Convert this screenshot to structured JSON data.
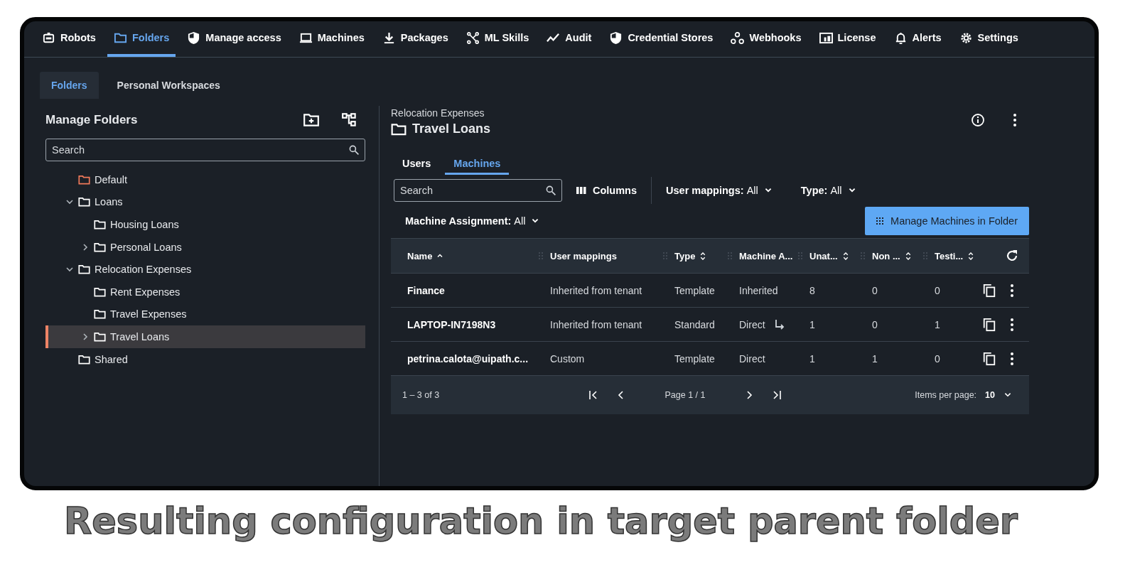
{
  "nav": [
    {
      "label": "Robots",
      "kind": "robot",
      "selected": false
    },
    {
      "label": "Folders",
      "kind": "folder",
      "selected": true
    },
    {
      "label": "Manage access",
      "kind": "shield",
      "selected": false
    },
    {
      "label": "Machines",
      "kind": "laptop",
      "selected": false
    },
    {
      "label": "Packages",
      "kind": "download",
      "selected": false
    },
    {
      "label": "ML Skills",
      "kind": "nodes",
      "selected": false
    },
    {
      "label": "Audit",
      "kind": "trend",
      "selected": false
    },
    {
      "label": "Credential Stores",
      "kind": "shield",
      "selected": false
    },
    {
      "label": "Webhooks",
      "kind": "webhook",
      "selected": false
    },
    {
      "label": "License",
      "kind": "devices",
      "selected": false
    },
    {
      "label": "Alerts",
      "kind": "bell",
      "selected": false
    },
    {
      "label": "Settings",
      "kind": "gear",
      "selected": false
    }
  ],
  "subtabs": [
    {
      "label": "Folders",
      "selected": true
    },
    {
      "label": "Personal Workspaces",
      "selected": false
    }
  ],
  "folders": {
    "title": "Manage Folders",
    "search": {
      "placeholder": "Search"
    },
    "tree": [
      {
        "label": "Default",
        "kind": "default",
        "selected": false
      },
      {
        "label": "Loans",
        "kind": "folder",
        "selected": false,
        "expanded": true,
        "children": [
          {
            "label": "Housing Loans",
            "kind": "folder",
            "selected": false
          },
          {
            "label": "Personal Loans",
            "kind": "folder",
            "selected": false,
            "expanded": false
          }
        ]
      },
      {
        "label": "Relocation Expenses",
        "kind": "folder",
        "selected": false,
        "expanded": true,
        "children": [
          {
            "label": "Rent Expenses",
            "kind": "folder",
            "selected": false
          },
          {
            "label": "Travel Expenses",
            "kind": "folder",
            "selected": false
          },
          {
            "label": "Travel Loans",
            "kind": "folder",
            "selected": true,
            "expanded": false
          }
        ]
      },
      {
        "label": "Shared",
        "kind": "folder",
        "selected": false
      }
    ]
  },
  "detail": {
    "breadcrumb": "Relocation Expenses",
    "title": "Travel Loans",
    "tabs": [
      {
        "label": "Users",
        "selected": false
      },
      {
        "label": "Machines",
        "selected": true
      }
    ],
    "search": {
      "placeholder": "Search"
    },
    "columns_button": "Columns",
    "filters": [
      {
        "label": "User mappings:",
        "value": "All"
      },
      {
        "label": "Type:",
        "value": "All"
      },
      {
        "label": "Machine Assignment:",
        "value": "All"
      }
    ],
    "manage_button": "Manage Machines in Folder",
    "table": {
      "columns": [
        {
          "label": "Name",
          "kind": "sorted"
        },
        {
          "label": "User mappings",
          "kind": "plain"
        },
        {
          "label": "Type",
          "kind": "sortable"
        },
        {
          "label": "Machine A...",
          "kind": "plain"
        },
        {
          "label": "Unat...",
          "kind": "sortable"
        },
        {
          "label": "Non ...",
          "kind": "sortable"
        },
        {
          "label": "Testi...",
          "kind": "sortable"
        }
      ],
      "rows": [
        {
          "cells": [
            "Finance",
            "Inherited from tenant",
            "Template",
            "Inherited",
            "8",
            "0",
            "0"
          ],
          "override_icon": false
        },
        {
          "cells": [
            "LAPTOP-IN7198N3",
            "Inherited from tenant",
            "Standard",
            "Direct",
            "1",
            "0",
            "1"
          ],
          "override_icon": true
        },
        {
          "cells": [
            "petrina.calota@uipath.c...",
            "Custom",
            "Template",
            "Direct",
            "1",
            "1",
            "0"
          ],
          "override_icon": false
        }
      ]
    },
    "pagination": {
      "range": "1 – 3 of 3",
      "page": "Page 1 / 1",
      "items_per_page_label": "Items per page:",
      "items_per_page": "10"
    }
  },
  "caption": "Resulting configuration in target parent folder"
}
